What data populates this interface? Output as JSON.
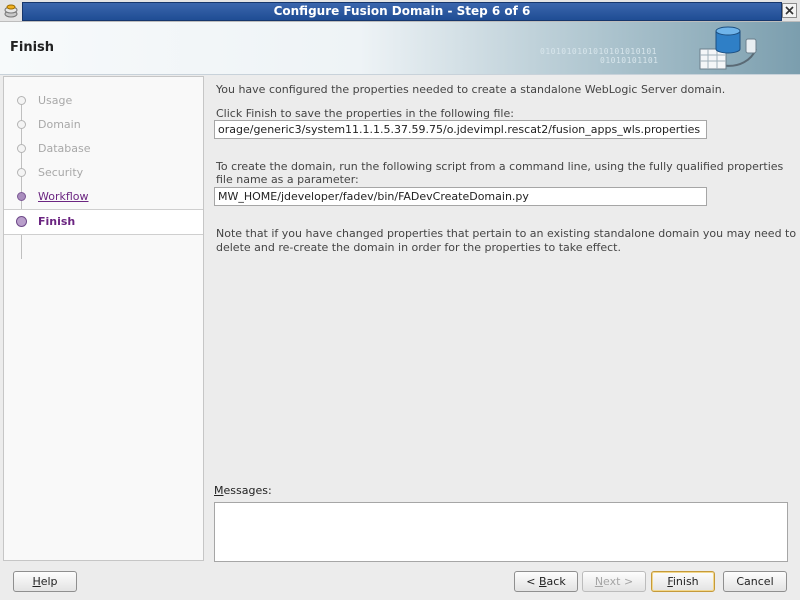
{
  "window": {
    "title": "Configure Fusion Domain - Step 6 of 6"
  },
  "header": {
    "title": "Finish",
    "binary_deco": "0101010101010101010101",
    "binary_deco2": "01010101101"
  },
  "nav": {
    "items": [
      {
        "label": "Usage",
        "state": "pending"
      },
      {
        "label": "Domain",
        "state": "pending"
      },
      {
        "label": "Database",
        "state": "pending"
      },
      {
        "label": "Security",
        "state": "pending"
      },
      {
        "label": "Workflow",
        "state": "done"
      },
      {
        "label": "Finish",
        "state": "current"
      }
    ]
  },
  "content": {
    "intro": "You have configured the properties needed to create a standalone WebLogic Server domain.",
    "save_prompt": "Click Finish to save the properties in the following file:",
    "properties_file": "orage/generic3/system11.1.1.5.37.59.75/o.jdevimpl.rescat2/fusion_apps_wls.properties",
    "script_prompt_line1": "To create the domain, run the following script from a command line, using the fully qualified properties",
    "script_prompt_line2": "file name as a parameter:",
    "script_path": "MW_HOME/jdeveloper/fadev/bin/FADevCreateDomain.py",
    "note_line1": "Note that if you have changed properties that pertain to an existing standalone domain you may need to",
    "note_line2": "delete and re-create the domain in order for the properties to take effect.",
    "messages_label_mnemonic": "M",
    "messages_label_rest": "essages:",
    "messages": ""
  },
  "buttons": {
    "help": {
      "mn": "H",
      "rest": "elp"
    },
    "back": {
      "pre": "< ",
      "mn": "B",
      "rest": "ack"
    },
    "next": {
      "pre": "",
      "mn": "N",
      "rest": "ext >"
    },
    "finish": {
      "mn": "F",
      "rest": "inish"
    },
    "cancel": {
      "label": "Cancel"
    }
  },
  "colors": {
    "title_bar": "#2a58a0",
    "accent_purple": "#6b2581",
    "default_button_border": "#c59a3a"
  }
}
